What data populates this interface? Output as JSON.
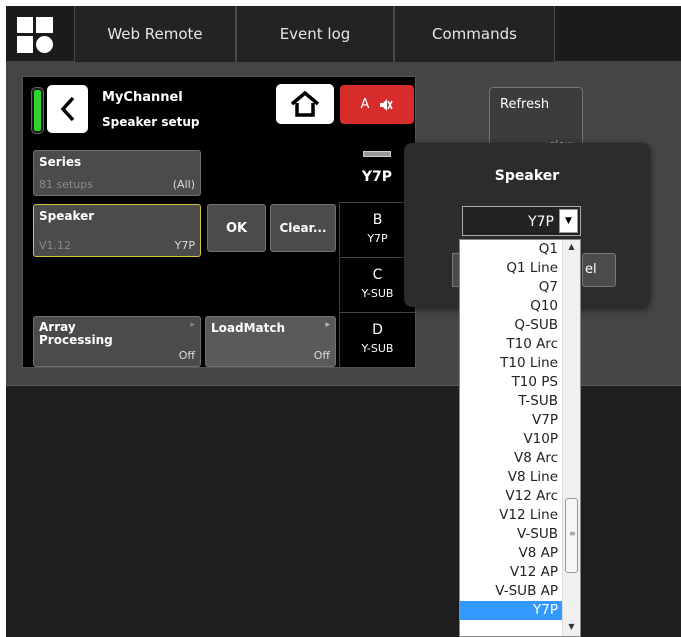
{
  "nav": {
    "tabs": [
      "Web Remote",
      "Event log",
      "Commands"
    ]
  },
  "channel": {
    "name": "MyChannel",
    "subtitle": "Speaker setup",
    "mute_label": "A"
  },
  "series": {
    "title": "Series",
    "count": "81 setups",
    "value": "(All)"
  },
  "speaker": {
    "title": "Speaker",
    "version": "V1.12",
    "value": "Y7P"
  },
  "ok_label": "OK",
  "clear_label": "Clear...",
  "array_processing": {
    "title": "Array Processing",
    "value": "Off"
  },
  "loadmatch": {
    "title": "LoadMatch",
    "value": "Off"
  },
  "channels": [
    {
      "id": "A",
      "speaker": "Y7P"
    },
    {
      "id": "B",
      "speaker": "Y7P"
    },
    {
      "id": "C",
      "speaker": "Y-SUB"
    },
    {
      "id": "D",
      "speaker": "Y-SUB"
    }
  ],
  "refresh": {
    "label": "Refresh",
    "sub": "slow"
  },
  "dialog": {
    "title": "Speaker",
    "selected": "Y7P",
    "cancel_fragment": "el",
    "options": [
      "Q1",
      "Q1 Line",
      "Q7",
      "Q10",
      "Q-SUB",
      "T10 Arc",
      "T10 Line",
      "T10 PS",
      "T-SUB",
      "V7P",
      "V10P",
      "V8 Arc",
      "V8 Line",
      "V12 Arc",
      "V12 Line",
      "V-SUB",
      "V8 AP",
      "V12 AP",
      "V-SUB AP",
      "Y7P"
    ],
    "selected_index": 19
  },
  "colors": {
    "accent_green": "#2fd32f",
    "mute_red": "#d62c2c",
    "selection_blue": "#3399ff",
    "highlight_yellow": "#d8c23a"
  }
}
